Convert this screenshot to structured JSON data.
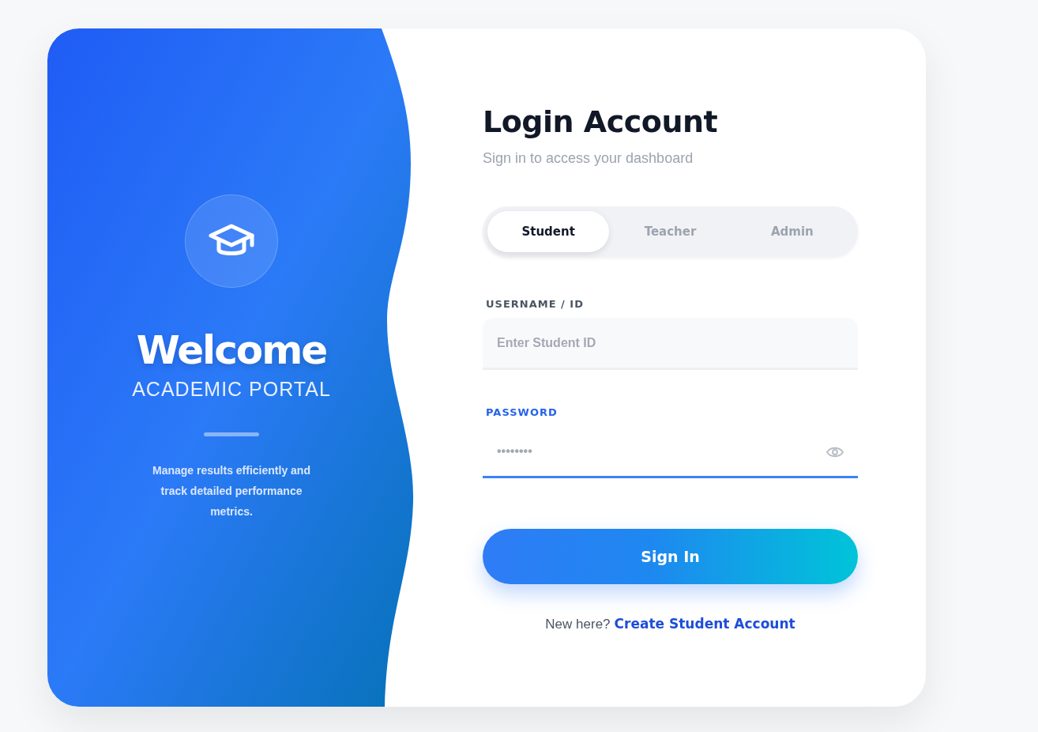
{
  "brand_panel": {
    "title": "Welcome",
    "subtitle": "ACADEMIC PORTAL",
    "description": "Manage results efficiently and track detailed performance metrics."
  },
  "form": {
    "title": "Login Account",
    "subtitle": "Sign in to access your dashboard",
    "roles": [
      {
        "label": "Student",
        "selected": true
      },
      {
        "label": "Teacher",
        "selected": false
      },
      {
        "label": "Admin",
        "selected": false
      }
    ],
    "fields": [
      {
        "kind": "text",
        "label": "USERNAME / ID",
        "placeholder": "Enter Student ID",
        "focused": false
      },
      {
        "kind": "password",
        "label": "PASSWORD",
        "placeholder": "••••••••",
        "focused": true
      }
    ],
    "submit": "Sign In",
    "signup_prompt": "New here?",
    "signup_link": "Create Student Account"
  }
}
